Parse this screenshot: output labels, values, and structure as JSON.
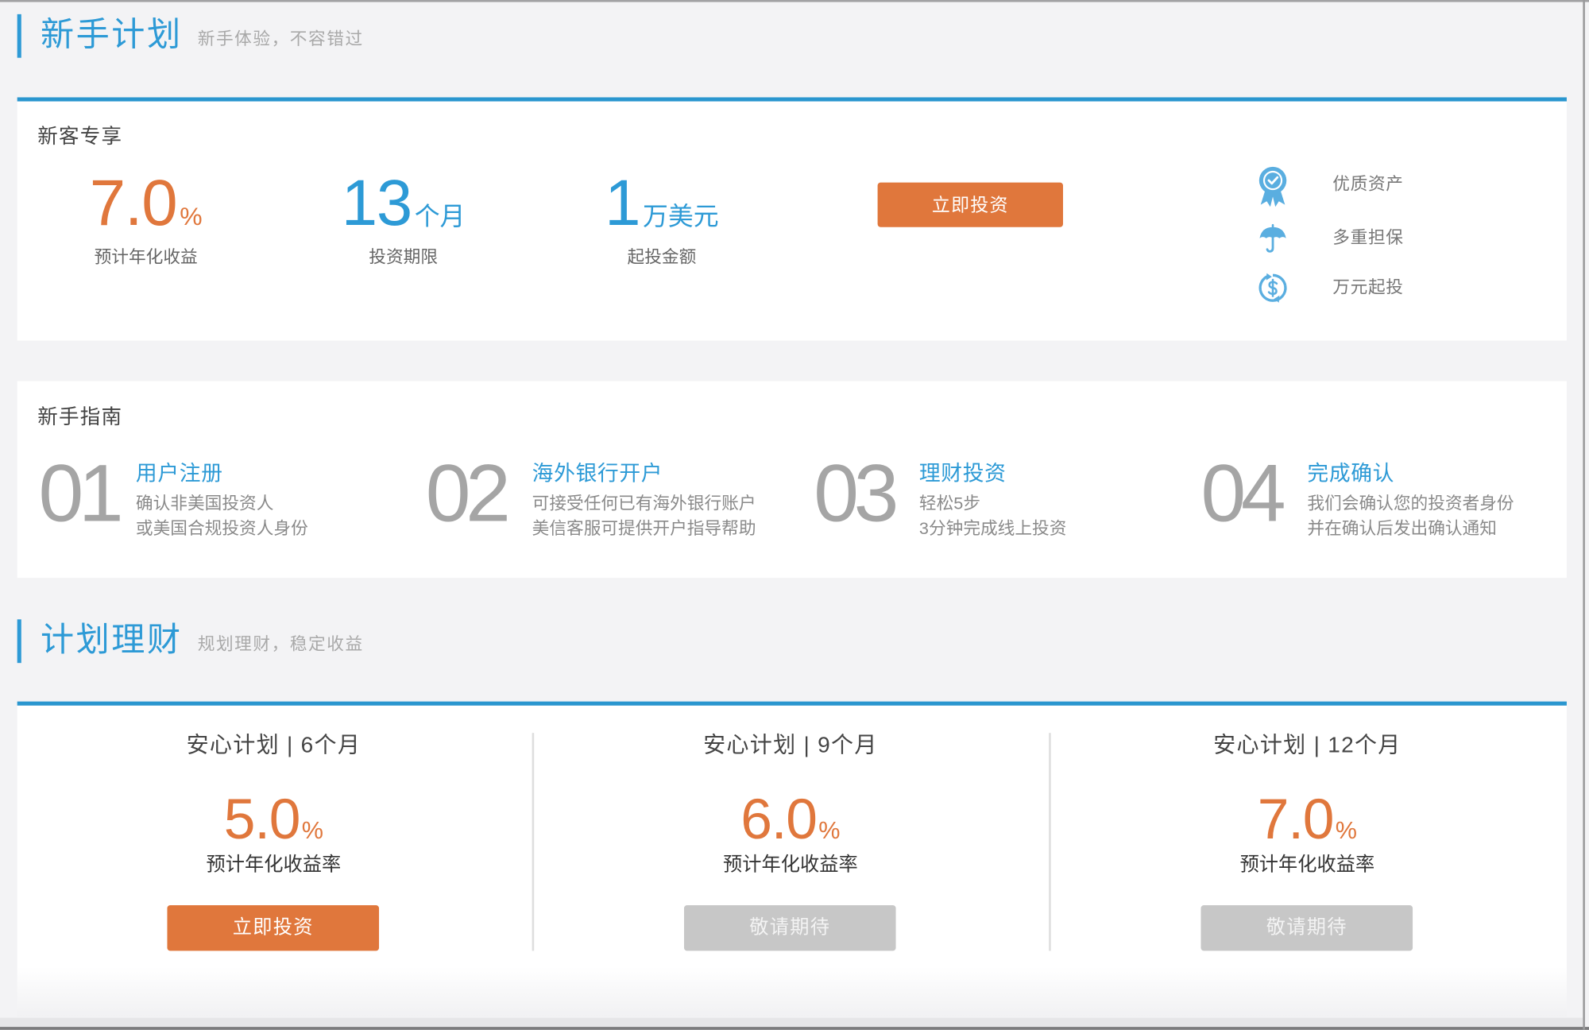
{
  "colors": {
    "page_bg": "#f3f3f5",
    "brand_blue": "#2d9ad6",
    "accent_orange": "#e0773c",
    "disabled_gray": "#c7c7c7"
  },
  "newbie_section": {
    "title": "新手计划",
    "subtitle": "新手体验，不容错过"
  },
  "offer": {
    "heading": "新客专享",
    "stats": [
      {
        "value": "7.0",
        "unit": "%",
        "label": "预计年化收益",
        "color": "#e0773c"
      },
      {
        "value": "13",
        "unit": "个月",
        "label": "投资期限",
        "color": "#2d9ad6"
      },
      {
        "value": "1",
        "unit": "万美元",
        "label": "起投金额",
        "color": "#2d9ad6"
      }
    ],
    "button_label": "立即投资",
    "features": [
      {
        "icon": "medal-icon",
        "label": "优质资产"
      },
      {
        "icon": "umbrella-icon",
        "label": "多重担保"
      },
      {
        "icon": "dollar-refresh-icon",
        "label": "万元起投"
      }
    ]
  },
  "guide": {
    "heading": "新手指南",
    "steps": [
      {
        "num": "01",
        "title": "用户注册",
        "lines": [
          "确认非美国投资人",
          "或美国合规投资人身份"
        ]
      },
      {
        "num": "02",
        "title": "海外银行开户",
        "lines": [
          "可接受任何已有海外银行账户",
          "美信客服可提供开户指导帮助"
        ]
      },
      {
        "num": "03",
        "title": "理财投资",
        "lines": [
          "轻松5步",
          "3分钟完成线上投资"
        ]
      },
      {
        "num": "04",
        "title": "完成确认",
        "lines": [
          "我们会确认您的投资者身份",
          "并在确认后发出确认通知"
        ]
      }
    ]
  },
  "plans_section": {
    "title": "计划理财",
    "subtitle": "规划理财，稳定收益"
  },
  "plans": [
    {
      "title": "安心计划 | 6个月",
      "rate": "5.0",
      "unit": "%",
      "rate_label": "预计年化收益率",
      "button_label": "立即投资",
      "enabled": true
    },
    {
      "title": "安心计划 | 9个月",
      "rate": "6.0",
      "unit": "%",
      "rate_label": "预计年化收益率",
      "button_label": "敬请期待",
      "enabled": false
    },
    {
      "title": "安心计划 | 12个月",
      "rate": "7.0",
      "unit": "%",
      "rate_label": "预计年化收益率",
      "button_label": "敬请期待",
      "enabled": false
    }
  ]
}
